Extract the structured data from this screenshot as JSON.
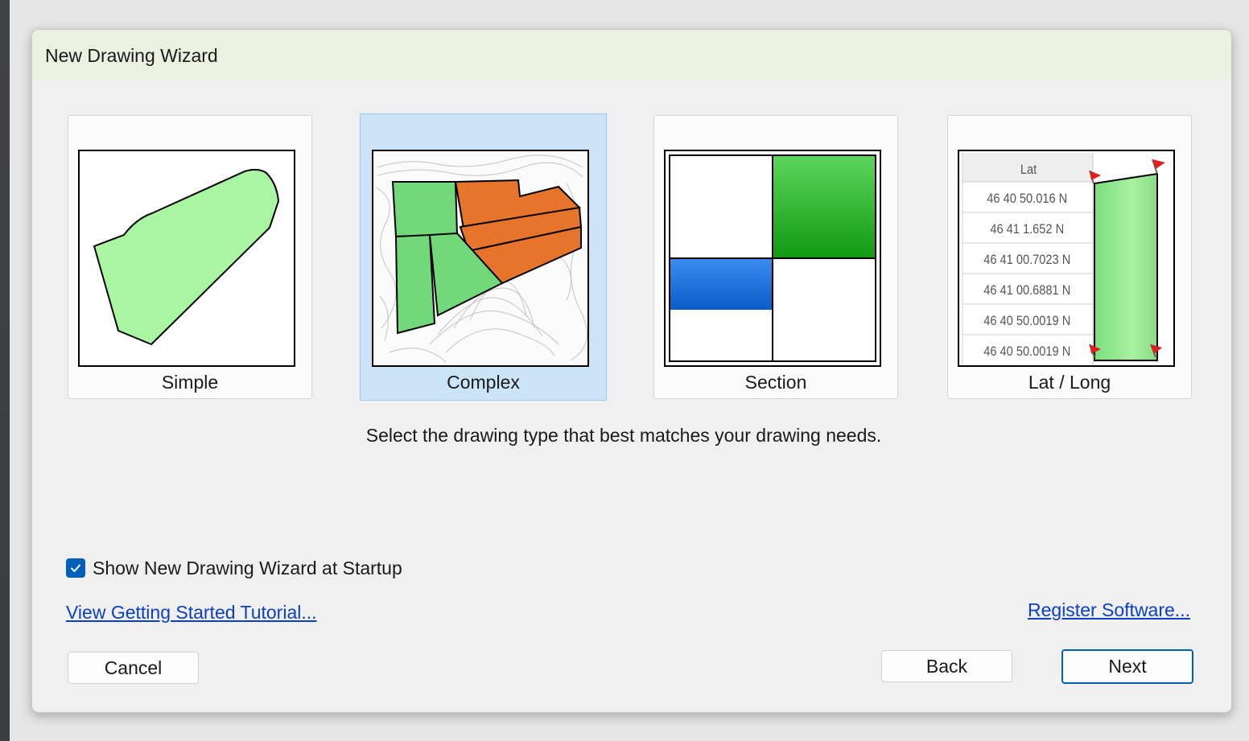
{
  "dialog": {
    "title": "New Drawing Wizard",
    "instruction": "Select the drawing type that best matches your drawing needs.",
    "options": [
      {
        "label": "Simple",
        "selected": false
      },
      {
        "label": "Complex",
        "selected": true
      },
      {
        "label": "Section",
        "selected": false
      },
      {
        "label": "Lat / Long",
        "selected": false
      }
    ],
    "latlong_table": {
      "header": "Lat",
      "rows": [
        "46 40 50.016 N",
        "46 41 1.652 N",
        "46 41 00.7023 N",
        "46 41 00.6881 N",
        "46 40 50.0019 N",
        "46 40 50.0019 N"
      ]
    },
    "startup_checkbox": {
      "label": "Show New Drawing Wizard at Startup",
      "checked": true
    },
    "tutorial_link": "View Getting Started Tutorial...",
    "register_link": "Register Software...",
    "buttons": {
      "cancel": "Cancel",
      "back": "Back",
      "next": "Next"
    }
  },
  "colors": {
    "accent": "#005fb8",
    "selected_card": "#cce4f7",
    "title_bar": "#eaf1df",
    "shape_green": "#a8f5a2",
    "shape_orange": "#e7742b",
    "section_green": "#1b9e1b",
    "section_blue": "#1f6fd9",
    "link": "#0b3fc4"
  }
}
